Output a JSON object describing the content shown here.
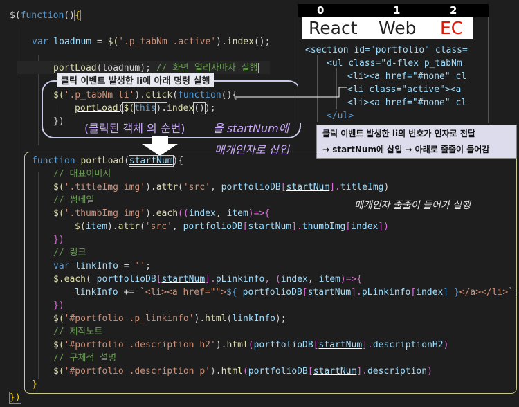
{
  "code": {
    "l1": {
      "a": "$(",
      "b": "function",
      "c": "()",
      "d": "{"
    },
    "l2": {
      "a": "var",
      "b": "loadnum",
      "c": " = ",
      "d": "$(",
      "e": "'.p_tabNm .active'",
      "f": ").",
      "g": "index",
      "h": "();"
    },
    "l3": {
      "a": "portLoad",
      "b": "(loadnum);",
      "c": " // 화면 열리자마자 실행"
    },
    "l4": {
      "a": "$(",
      "b": "'.p_tabNm li'",
      "c": ").",
      "d": "click",
      "e": "(",
      "f": "function",
      "g": "(){"
    },
    "l5": {
      "a": "portLoad",
      "b": "(",
      "c": "$(",
      "d": "this",
      "e": ").",
      "f": "index",
      "g": "()",
      "h": ");"
    },
    "l6": {
      "a": "})"
    },
    "f1": {
      "a": "function",
      "b": " portLoad",
      "c": "(",
      "d": "startNum",
      "e": "){"
    },
    "c1": "// 대표이미지",
    "t1": {
      "a": "$(",
      "b": "'.titleImg img'",
      "c": ").",
      "d": "attr",
      "e": "(",
      "f": "'src'",
      "g": ", ",
      "h": "portfolioDB",
      "i": "[",
      "j": "startNum",
      "k": "].",
      "l": "titleImg",
      "m": ")"
    },
    "c2": "// 썸네일",
    "t2": {
      "a": "$(",
      "b": "'.thumbImg img'",
      "c": ").",
      "d": "each",
      "e": "((",
      "f": "index",
      "g": ", ",
      "h": "item",
      "i": ")=>{"
    },
    "t3": {
      "a": "$(",
      "b": "item",
      "c": ").",
      "d": "attr",
      "e": "(",
      "f": "'src'",
      "g": ", ",
      "h": "portfolioDB",
      "i": "[",
      "j": "startNum",
      "k": "].",
      "l": "thumbImg",
      "m": "[",
      "n": "index",
      "o": "])"
    },
    "t4": "})",
    "c3": "// 링크",
    "t5": {
      "a": "var",
      "b": " linkInfo",
      "c": " = ",
      "d": "''",
      "e": ";"
    },
    "t6": {
      "a": "$.",
      "b": "each",
      "c": "( ",
      "d": "portfolioDB",
      "e": "[",
      "f": "startNum",
      "g": "].",
      "h": "pLinkinfo",
      "i": ", (",
      "j": "index",
      "k": ", ",
      "l": "item",
      "m": ")=>{"
    },
    "t7": {
      "a": "linkInfo",
      "b": " += ",
      "c": "`<li><a href=\"\">",
      "d": "${ ",
      "e": "portfolioDB",
      "f": "[",
      "g": "startNum",
      "h": "].",
      "i": "pLinkinfo",
      "j": "[",
      "k": "index",
      "l": "] }",
      "m": "</a></li>`",
      "n": ";"
    },
    "t8": "})",
    "t9": {
      "a": "$(",
      "b": "'#portfolio .p_linkinfo'",
      "c": ").",
      "d": "html",
      "e": "(",
      "f": "linkInfo",
      "g": ");"
    },
    "c4": "// 제작노트",
    "t10": {
      "a": "$(",
      "b": "'#portfolio .description h2'",
      "c": ").",
      "d": "html",
      "e": "(",
      "f": "portfolioDB",
      "g": "[",
      "h": "startNum",
      "i": "].",
      "j": "descriptionH2",
      "k": ")"
    },
    "c5": "// 구체적 설명",
    "t11": {
      "a": "$(",
      "b": "'#portfolio .description p'",
      "c": ").",
      "d": "html",
      "e": "(",
      "f": "portfolioDB",
      "g": "[",
      "h": "startNum",
      "i": "].",
      "j": "description",
      "k": ")"
    },
    "close1": "}",
    "close2": "})"
  },
  "annotations": {
    "event_label": "클릭 이벤트 발생한 li에 아래 명령 실행",
    "clicked_order": "(클릭된 객체 의 순번)",
    "to_startnum": "을 startNum에",
    "arg_insert": "매개인자로 삽입",
    "arg_flow": "매개인자 줄줄이 들어가 실행",
    "tooltip_line1": "클릭 이벤트 발생한 li의 번호가 인자로 전달",
    "tooltip_line2": "→ startNum에 삽입 → 아래로 줄줄이 들어감"
  },
  "preview": {
    "indices": [
      "0",
      "1",
      "2"
    ],
    "tabs": [
      "React",
      "Web",
      "EC"
    ],
    "html_lines": [
      "<section id=\"portfolio\" class=",
      "<ul class=\"d-flex p_tabNm",
      "<li><a href=\"#none\" cl",
      "<li class=\"active\"><a",
      "<li><a href=\"#none\" cl",
      "</ul>"
    ]
  },
  "colors": {
    "background": "#1e1e1e",
    "keyword": "#569cd6",
    "function": "#dcdcaa",
    "string": "#ce9178",
    "variable": "#9cdcfe",
    "comment": "#6a9955",
    "annotation_border": "#c9c98a",
    "tab_accent": "#e51400"
  }
}
